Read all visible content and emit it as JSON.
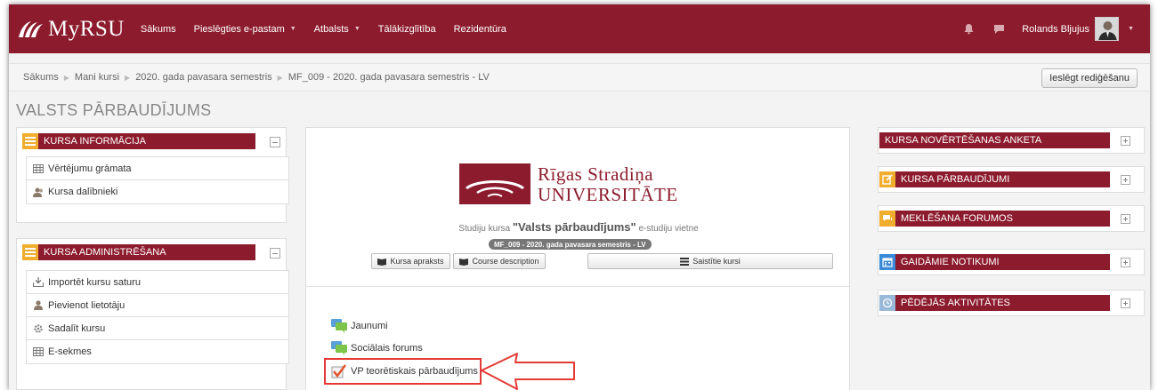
{
  "navbar": {
    "brand": "MyRSU",
    "links": [
      {
        "label": "Sākums",
        "has_menu": false
      },
      {
        "label": "Pieslēgties e-pastam",
        "has_menu": true
      },
      {
        "label": "Atbalsts",
        "has_menu": true
      },
      {
        "label": "Tālākizglītība",
        "has_menu": false
      },
      {
        "label": "Rezidentūra",
        "has_menu": false
      }
    ],
    "user_name": "Rolands Bljujus"
  },
  "breadcrumb": {
    "items": [
      "Sākums",
      "Mani kursi",
      "2020. gada pavasara semestris",
      "MF_009 - 2020. gada pavasara semestris - LV"
    ]
  },
  "edit_button": "Ieslēgt rediģēšanu",
  "page_title": "VALSTS PĀRBAUDĪJUMS",
  "left_blocks": {
    "info": {
      "title": "KURSA INFORMĀCIJA",
      "items": [
        "Vērtējumu grāmata",
        "Kursa dalībnieki"
      ]
    },
    "admin": {
      "title": "KURSA ADMINISTRĒŠANA",
      "items": [
        "Importēt kursu saturu",
        "Pievienot lietotāju",
        "Sadalīt kursu",
        "E-sekmes"
      ]
    }
  },
  "center": {
    "university_line1": "Rīgas Stradiņa",
    "university_line2": "Universitāte",
    "subtitle_prefix": "Studiju kursa",
    "course_name": "\"Valsts pārbaudījums\"",
    "subtitle_suffix": "e-studiju vietne",
    "course_code": "MF_009 - 2020. gada pavasara semestris - LV",
    "buttons": {
      "description_lv": "Kursa apraksts",
      "description_en": "Course description",
      "related": "Saistītie kursi"
    },
    "activities": [
      "Jaunumi",
      "Sociālais forums",
      "VP teorētiskais pārbaudījums"
    ]
  },
  "right_blocks": [
    {
      "title": "KURSA NOVĒRTĒŠANAS ANKETA",
      "icon": "none"
    },
    {
      "title": "KURSA PĀRBAUDĪJUMI",
      "icon": "edit-icon"
    },
    {
      "title": "MEKLĒŠANA FORUMOS",
      "icon": "chat-icon"
    },
    {
      "title": "GAIDĀMIE NOTIKUMI",
      "icon": "calendar-icon"
    },
    {
      "title": "PĒDĒJĀS AKTIVITĀTES",
      "icon": "clock-icon"
    }
  ],
  "colors": {
    "brand": "#8c1c2d",
    "block_icon_orange": "#f0ad2e",
    "highlight": "#e53935"
  }
}
